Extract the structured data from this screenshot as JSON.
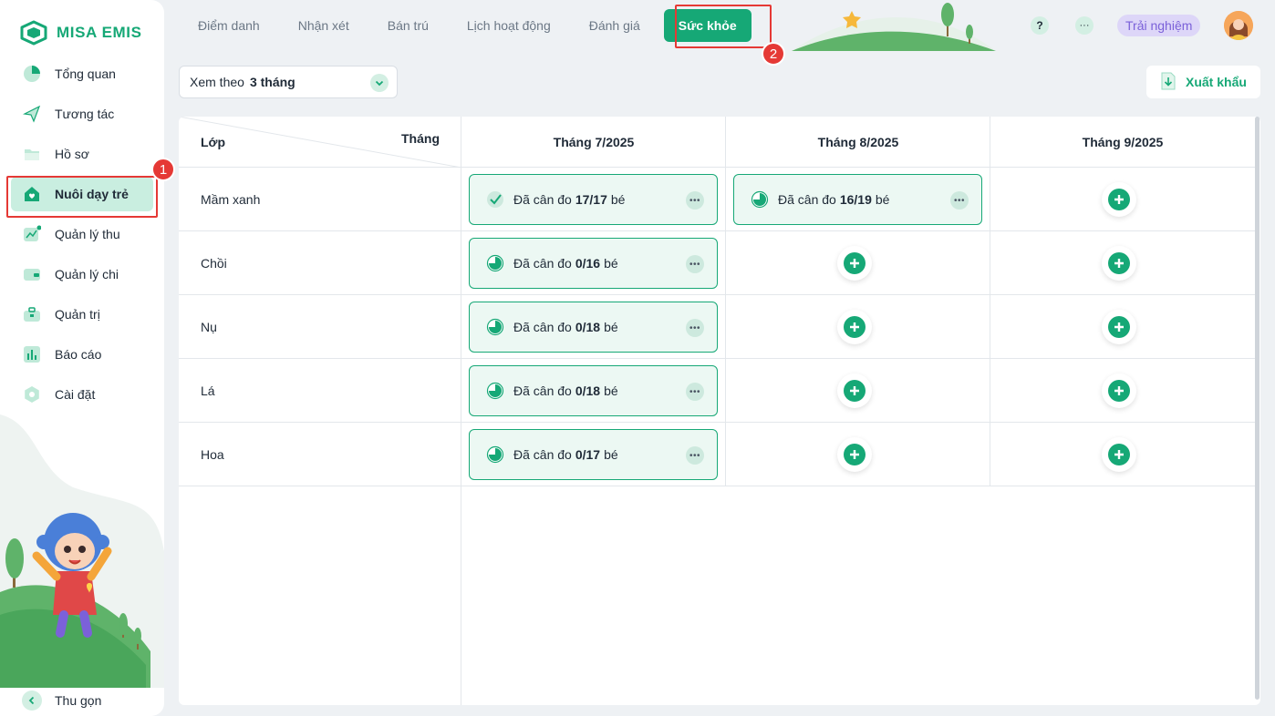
{
  "brand": {
    "name": "MISA EMIS"
  },
  "sidebar": {
    "items": [
      {
        "label": "Tổng quan",
        "icon": "pie-chart-icon"
      },
      {
        "label": "Tương tác",
        "icon": "send-icon"
      },
      {
        "label": "Hồ sơ",
        "icon": "folder-icon"
      },
      {
        "label": "Nuôi dạy trẻ",
        "icon": "heart-home-icon",
        "active": true
      },
      {
        "label": "Quản lý thu",
        "icon": "trend-icon"
      },
      {
        "label": "Quản lý chi",
        "icon": "wallet-icon"
      },
      {
        "label": "Quản trị",
        "icon": "briefcase-icon"
      },
      {
        "label": "Báo cáo",
        "icon": "bar-chart-icon"
      },
      {
        "label": "Cài đặt",
        "icon": "gear-icon"
      }
    ],
    "collapse_label": "Thu gọn",
    "step_badge": "1"
  },
  "tabs": [
    "Điểm danh",
    "Nhận xét",
    "Bán trú",
    "Lịch hoạt động",
    "Đánh giá",
    "Sức khỏe"
  ],
  "active_tab": "Sức khỏe",
  "tab_step_badge": "2",
  "header": {
    "help": "?",
    "more": "···",
    "trial_label": "Trải nghiệm"
  },
  "toolbar": {
    "view_label": "Xem theo",
    "view_value": "3 tháng",
    "export_label": "Xuất khẩu"
  },
  "table": {
    "class_header": "Lớp",
    "month_header": "Tháng",
    "months": [
      "Tháng 7/2025",
      "Tháng 8/2025",
      "Tháng 9/2025"
    ],
    "rows": [
      {
        "name": "Mầm xanh",
        "cells": [
          {
            "type": "status",
            "prefix": "Đã cân đo",
            "count": "17/17",
            "suffix": "bé",
            "complete": true
          },
          {
            "type": "status",
            "prefix": "Đã cân đo",
            "count": "16/19",
            "suffix": "bé",
            "complete": false
          },
          {
            "type": "add"
          }
        ]
      },
      {
        "name": "Chồi",
        "cells": [
          {
            "type": "status",
            "prefix": "Đã cân đo",
            "count": "0/16",
            "suffix": "bé",
            "complete": false
          },
          {
            "type": "add"
          },
          {
            "type": "add"
          }
        ]
      },
      {
        "name": "Nụ",
        "cells": [
          {
            "type": "status",
            "prefix": "Đã cân đo",
            "count": "0/18",
            "suffix": "bé",
            "complete": false
          },
          {
            "type": "add"
          },
          {
            "type": "add"
          }
        ]
      },
      {
        "name": "Lá",
        "cells": [
          {
            "type": "status",
            "prefix": "Đã cân đo",
            "count": "0/18",
            "suffix": "bé",
            "complete": false
          },
          {
            "type": "add"
          },
          {
            "type": "add"
          }
        ]
      },
      {
        "name": "Hoa",
        "cells": [
          {
            "type": "status",
            "prefix": "Đã cân đo",
            "count": "0/17",
            "suffix": "bé",
            "complete": false
          },
          {
            "type": "add"
          },
          {
            "type": "add"
          }
        ]
      }
    ]
  },
  "colors": {
    "accent": "#16a876",
    "highlight": "#e53935",
    "trial": "#7b61d9"
  }
}
